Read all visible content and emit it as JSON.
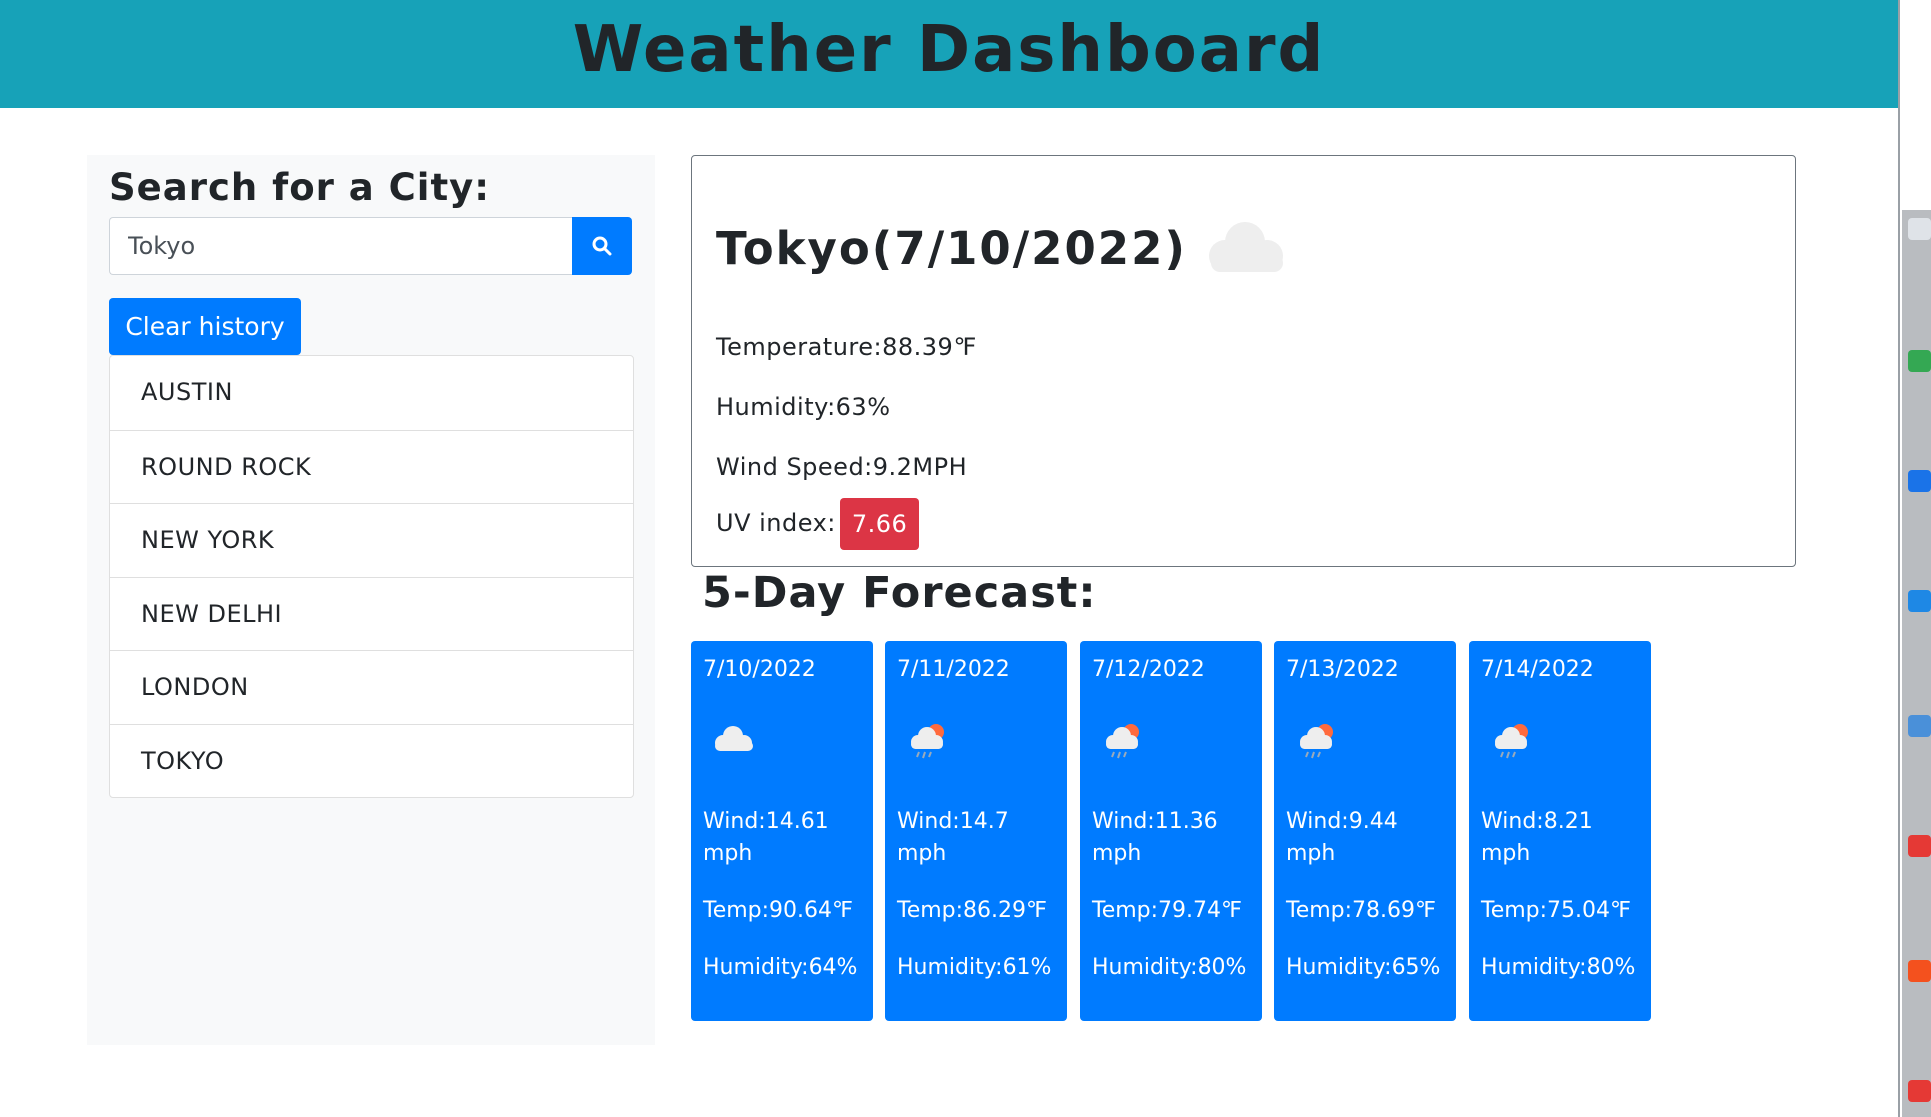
{
  "header": {
    "title": "Weather Dashboard"
  },
  "sidebar": {
    "heading": "Search for a City:",
    "search_value": "Tokyo",
    "search_icon": "search-icon",
    "clear_label": "Clear history",
    "history": [
      "AUSTIN",
      "ROUND ROCK",
      "NEW YORK",
      "NEW DELHI",
      "LONDON",
      "TOKYO"
    ]
  },
  "current": {
    "title": "Tokyo(7/10/2022)",
    "icon": "cloud-icon",
    "temperature": "Temperature:88.39℉",
    "humidity": "Humidity:63%",
    "wind": "Wind Speed:9.2MPH",
    "uv_label": "UV index:",
    "uv_value": "7.66"
  },
  "forecast": {
    "heading": "5-Day Forecast:",
    "days": [
      {
        "date": "7/10/2022",
        "icon": "cloud-icon",
        "wind": "Wind:14.61 mph",
        "temp": "Temp:90.64℉",
        "humidity": "Humidity:64%"
      },
      {
        "date": "7/11/2022",
        "icon": "rain-cloud-icon",
        "wind": "Wind:14.7 mph",
        "temp": "Temp:86.29℉",
        "humidity": "Humidity:61%"
      },
      {
        "date": "7/12/2022",
        "icon": "rain-cloud-icon",
        "wind": "Wind:11.36 mph",
        "temp": "Temp:79.74℉",
        "humidity": "Humidity:80%"
      },
      {
        "date": "7/13/2022",
        "icon": "rain-cloud-icon",
        "wind": "Wind:9.44 mph",
        "temp": "Temp:78.69℉",
        "humidity": "Humidity:65%"
      },
      {
        "date": "7/14/2022",
        "icon": "rain-cloud-icon",
        "wind": "Wind:8.21 mph",
        "temp": "Temp:75.04℉",
        "humidity": "Humidity:80%"
      }
    ]
  },
  "colors": {
    "header": "#17a2b8",
    "primary": "#007bff",
    "danger": "#dc3545"
  }
}
